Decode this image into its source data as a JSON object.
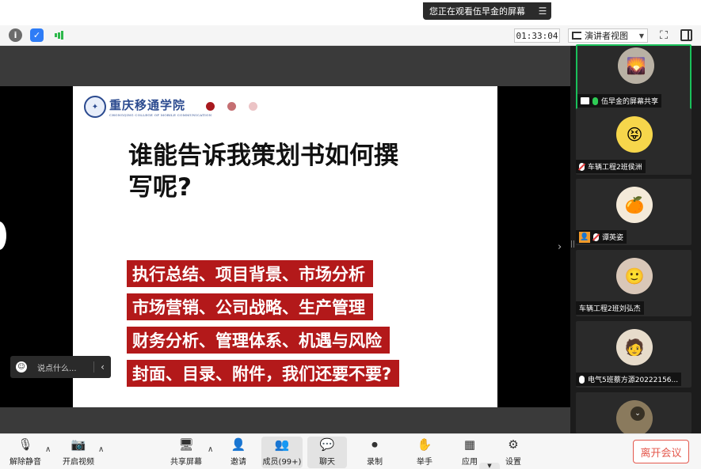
{
  "banner": {
    "viewing_text": "您正在观看伍早金的屏幕",
    "menu_icon": "menu-icon"
  },
  "toolbar": {
    "timer": "01:33:04",
    "view_mode": "演讲者视图",
    "icons": [
      "info-icon",
      "shield-icon",
      "signal-icon",
      "fullscreen-icon",
      "panel-icon"
    ]
  },
  "slide": {
    "school_name": "重庆移通学院",
    "school_name_en": "CHONGQING COLLEGE OF MOBILE COMMUNICATION",
    "title_line1": "谁能告诉我策划书如何撰",
    "title_line2": "写呢?",
    "bullets": [
      "执行总结、项目背景、市场分析",
      "市场营销、公司战略、生产管理",
      "财务分析、管理体系、机遇与风险",
      "封面、目录、附件，我们还要不要?"
    ],
    "dot_colors": [
      "#a8191e",
      "#c56f72",
      "#ecc4c6"
    ],
    "accent": "#b3191a"
  },
  "chat": {
    "placeholder": "说点什么..."
  },
  "participants": [
    {
      "name": "伍早金的屏幕共享",
      "mic": "on",
      "badge": "screen",
      "active": true
    },
    {
      "name": "车辆工程2班侯洲",
      "mic": "off",
      "badge": "none",
      "active": false
    },
    {
      "name": "谭英姿",
      "mic": "off",
      "badge": "person",
      "active": false
    },
    {
      "name": "车辆工程2班刘弘杰",
      "mic": "none",
      "badge": "none",
      "active": false
    },
    {
      "name": "电气5班蔡方源20222156...",
      "mic": "white",
      "badge": "none",
      "active": false
    },
    {
      "name": "",
      "mic": "none",
      "badge": "none",
      "active": false
    }
  ],
  "controls": {
    "unmute": "解除静音",
    "start_video": "开启视频",
    "share_screen": "共享屏幕",
    "invite": "邀请",
    "members": "成员(99+)",
    "chat": "聊天",
    "record": "录制",
    "raise_hand": "举手",
    "apps": "应用",
    "settings": "设置",
    "leave": "离开会议"
  }
}
